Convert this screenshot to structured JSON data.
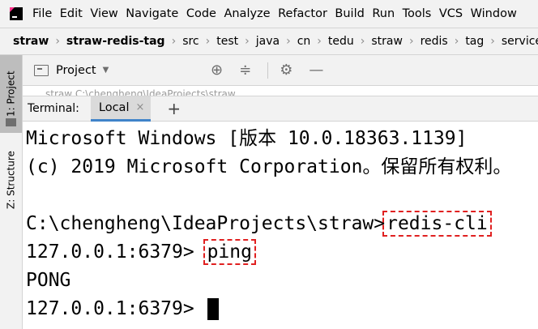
{
  "menu": {
    "items": [
      "File",
      "Edit",
      "View",
      "Navigate",
      "Code",
      "Analyze",
      "Refactor",
      "Build",
      "Run",
      "Tools",
      "VCS",
      "Window"
    ]
  },
  "breadcrumb": {
    "items": [
      "straw",
      "straw-redis-tag",
      "src",
      "test",
      "java",
      "cn",
      "tedu",
      "straw",
      "redis",
      "tag",
      "service"
    ]
  },
  "side_strip": {
    "project_tab": "1: Project",
    "structure_tab": "Z: Structure"
  },
  "project_panel": {
    "title": "Project",
    "icons": [
      "locate-icon",
      "collapse-icon",
      "gear-icon",
      "minimize-icon"
    ],
    "tree_peek_text": "straw  C:\\chengheng\\IdeaProjects\\straw"
  },
  "terminal": {
    "label": "Terminal:",
    "tab_label": "Local",
    "close_symbol": "×",
    "add_symbol": "+",
    "lines": {
      "l1": "Microsoft Windows [版本 10.0.18363.1139]",
      "l2": "(c) 2019 Microsoft Corporation。保留所有权利。",
      "l3": "",
      "l4_prompt": "C:\\chengheng\\IdeaProjects\\straw>",
      "l4_cmd": "redis-cli",
      "l5_prompt": "127.0.0.1:6379> ",
      "l5_cmd": "ping",
      "l6": "PONG",
      "l7_prompt": "127.0.0.1:6379> "
    },
    "highlight_color": "#e02020"
  }
}
